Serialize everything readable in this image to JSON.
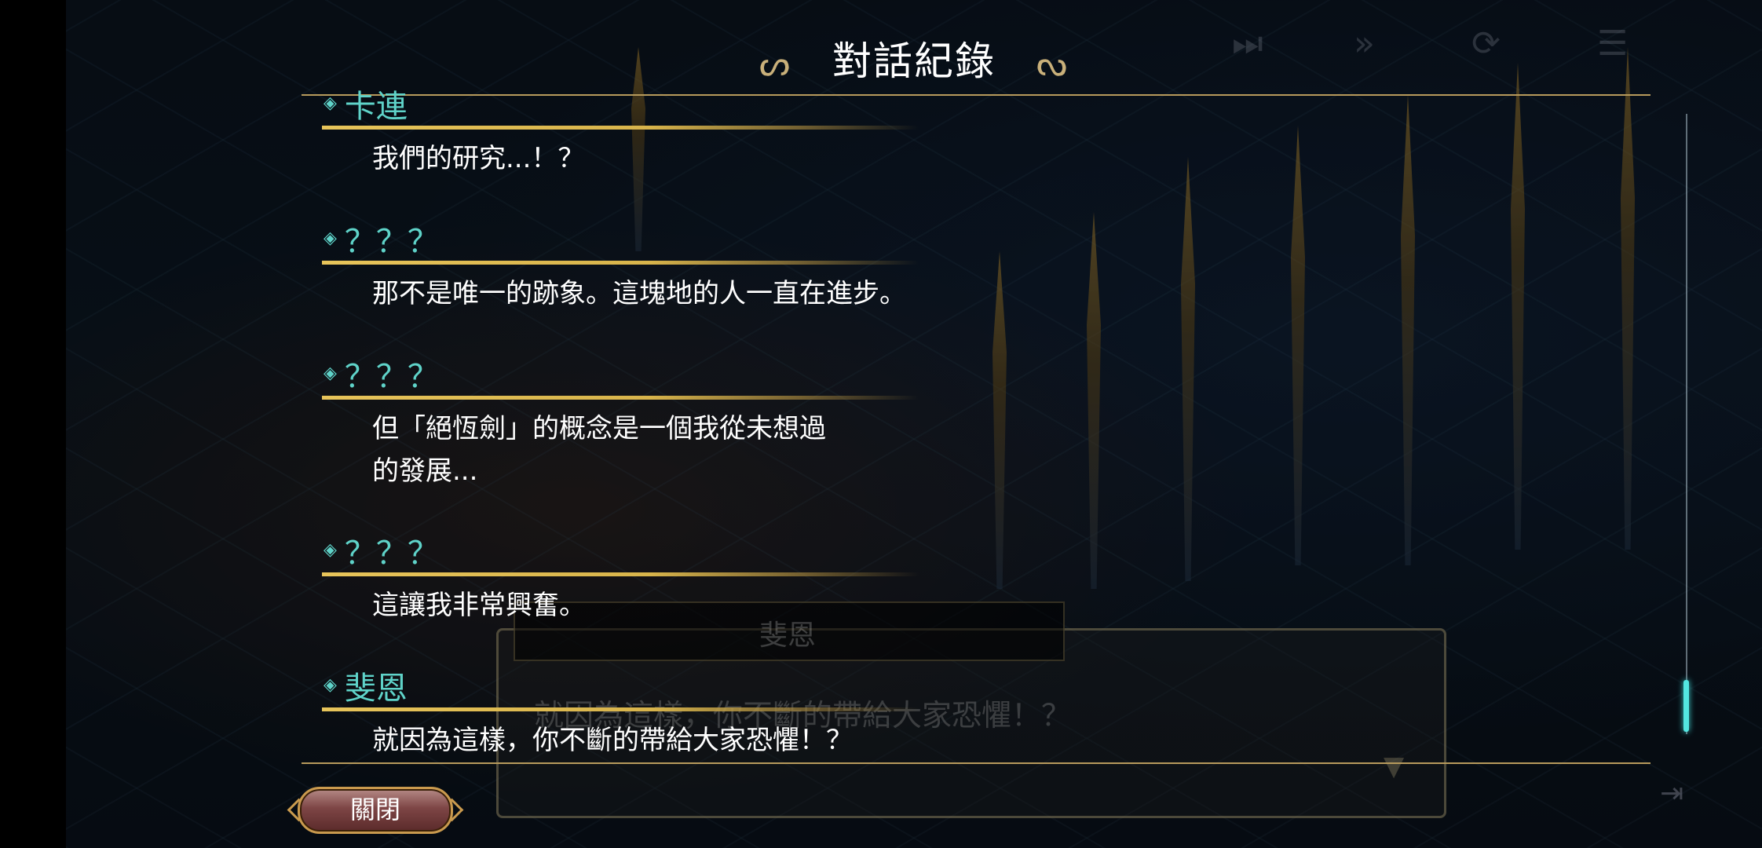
{
  "header": {
    "title": "對話紀錄",
    "ornament_left": "ᔕ",
    "ornament_right": "ᔓ"
  },
  "top_icons": [
    {
      "name": "fast-forward-icon",
      "glyph": "⏭"
    },
    {
      "name": "skip-icon",
      "glyph": "»"
    },
    {
      "name": "auto-icon",
      "glyph": "⟳"
    },
    {
      "name": "log-icon",
      "glyph": "☰"
    }
  ],
  "log": {
    "entries": [
      {
        "speaker": "卡連",
        "lines": [
          "我們的研究...！？"
        ]
      },
      {
        "speaker": "？？？",
        "lines": [
          "那不是唯一的跡象。這塊地的人一直在進步。"
        ]
      },
      {
        "speaker": "？？？",
        "lines": [
          "但「絕恆劍」的概念是一個我從未想過",
          "的發展..."
        ]
      },
      {
        "speaker": "？？？",
        "lines": [
          "這讓我非常興奮。"
        ]
      },
      {
        "speaker": "斐恩",
        "lines": [
          "就因為這樣，你不斷的帶給大家恐懼！？"
        ]
      }
    ]
  },
  "scrollbar": {
    "position_fraction": 1.0
  },
  "background_dialog": {
    "speaker": "斐恩",
    "text": "就因為這樣，你不斷的帶給大家恐懼！？"
  },
  "footer": {
    "close_label": "關閉"
  },
  "colors": {
    "speaker": "#5fd3c9",
    "accent_gold": "#e7c45a",
    "scroll_thumb": "#53e6e1"
  }
}
